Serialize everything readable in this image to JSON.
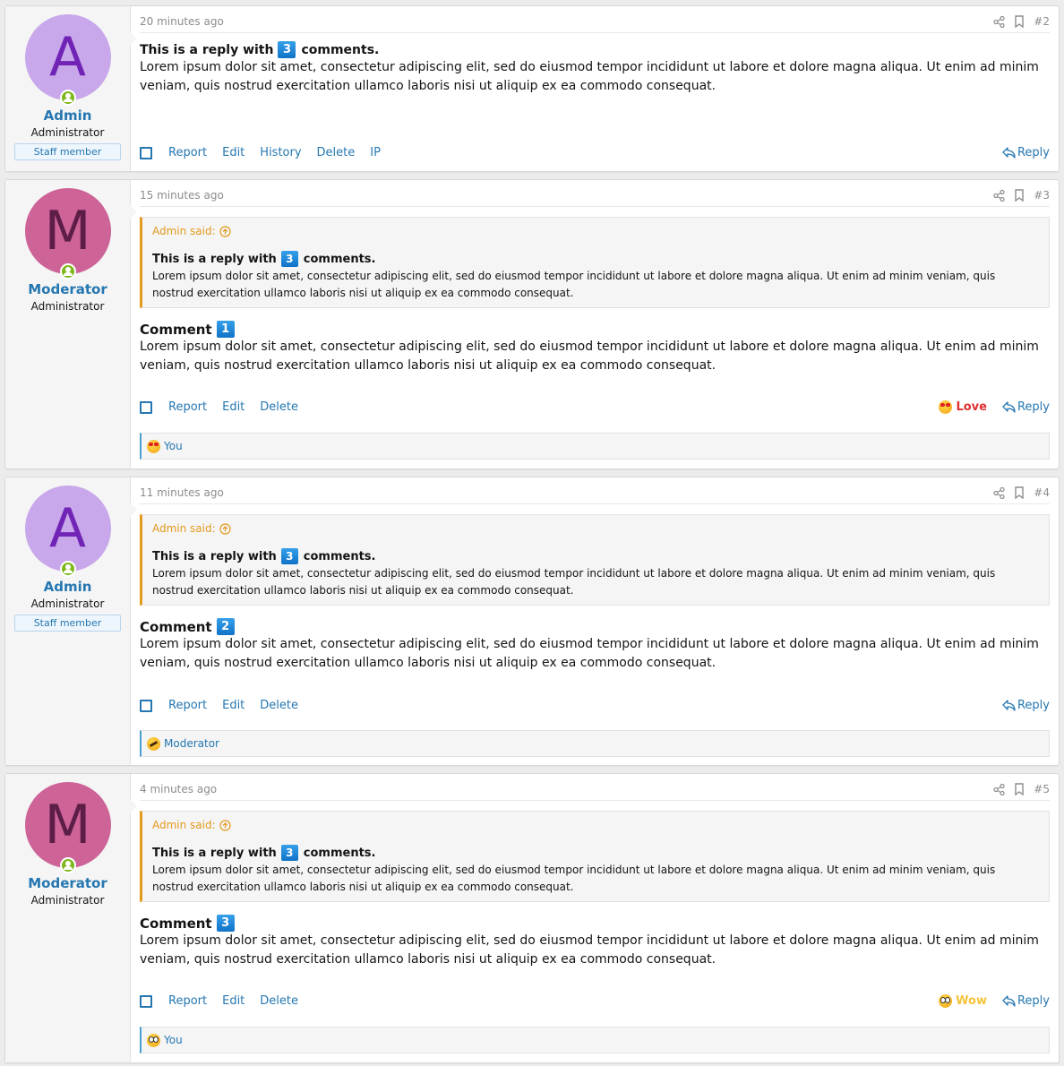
{
  "posts": [
    {
      "id": "2",
      "user": {
        "initial": "A",
        "name": "Admin",
        "title": "Administrator",
        "badge": "Staff member",
        "avatar_bg": "#c8a7eb",
        "avatar_fg": "#7123b5",
        "online": true
      },
      "time": "20 minutes ago",
      "number": "#2",
      "header_icons": [
        "share-icon",
        "bookmark-icon"
      ],
      "title_pre": "This is a reply with",
      "title_num": "3",
      "title_post": "comments.",
      "body": "Lorem ipsum dolor sit amet, consectetur adipiscing elit, sed do eiusmod tempor incididunt ut labore et dolore magna aliqua. Ut enim ad minim veniam, quis nostrud exercitation ullamco laboris nisi ut aliquip ex ea commodo consequat.",
      "actions": [
        "Report",
        "Edit",
        "History",
        "Delete",
        "IP"
      ],
      "reply_label": "Reply"
    },
    {
      "id": "3",
      "user": {
        "initial": "M",
        "name": "Moderator",
        "title": "Administrator",
        "avatar_bg": "#cd6396",
        "avatar_fg": "#5c1d47",
        "online": true
      },
      "time": "15 minutes ago",
      "number": "#3",
      "quote": {
        "author_label": "Admin said:",
        "title_pre": "This is a reply with",
        "title_num": "3",
        "title_post": "comments.",
        "body": "Lorem ipsum dolor sit amet, consectetur adipiscing elit, sed do eiusmod tempor incididunt ut labore et dolore magna aliqua. Ut enim ad minim veniam, quis nostrud exercitation ullamco laboris nisi ut aliquip ex ea commodo consequat."
      },
      "comment_label": "Comment",
      "comment_num": "1",
      "body": "Lorem ipsum dolor sit amet, consectetur adipiscing elit, sed do eiusmod tempor incididunt ut labore et dolore magna aliqua. Ut enim ad minim veniam, quis nostrud exercitation ullamco laboris nisi ut aliquip ex ea commodo consequat.",
      "actions": [
        "Report",
        "Edit",
        "Delete"
      ],
      "reaction_state": {
        "label": "Love",
        "icon": "love-emoji-icon",
        "color": "#e03030"
      },
      "reply_label": "Reply",
      "reactions_bar": {
        "icon": "love-emoji-icon",
        "users": "You"
      }
    },
    {
      "id": "4",
      "user": {
        "initial": "A",
        "name": "Admin",
        "title": "Administrator",
        "badge": "Staff member",
        "avatar_bg": "#c8a7eb",
        "avatar_fg": "#7123b5",
        "online": true
      },
      "time": "11 minutes ago",
      "number": "#4",
      "quote": {
        "author_label": "Admin said:",
        "title_pre": "This is a reply with",
        "title_num": "3",
        "title_post": "comments.",
        "body": "Lorem ipsum dolor sit amet, consectetur adipiscing elit, sed do eiusmod tempor incididunt ut labore et dolore magna aliqua. Ut enim ad minim veniam, quis nostrud exercitation ullamco laboris nisi ut aliquip ex ea commodo consequat."
      },
      "comment_label": "Comment",
      "comment_num": "2",
      "body": "Lorem ipsum dolor sit amet, consectetur adipiscing elit, sed do eiusmod tempor incididunt ut labore et dolore magna aliqua. Ut enim ad minim veniam, quis nostrud exercitation ullamco laboris nisi ut aliquip ex ea commodo consequat.",
      "actions": [
        "Report",
        "Edit",
        "Delete"
      ],
      "reply_label": "Reply",
      "reactions_bar": {
        "icon": "haha-emoji-icon",
        "users": "Moderator"
      }
    },
    {
      "id": "5",
      "user": {
        "initial": "M",
        "name": "Moderator",
        "title": "Administrator",
        "avatar_bg": "#cd6396",
        "avatar_fg": "#5c1d47",
        "online": true
      },
      "time": "4 minutes ago",
      "number": "#5",
      "quote": {
        "author_label": "Admin said:",
        "title_pre": "This is a reply with",
        "title_num": "3",
        "title_post": "comments.",
        "body": "Lorem ipsum dolor sit amet, consectetur adipiscing elit, sed do eiusmod tempor incididunt ut labore et dolore magna aliqua. Ut enim ad minim veniam, quis nostrud exercitation ullamco laboris nisi ut aliquip ex ea commodo consequat."
      },
      "comment_label": "Comment",
      "comment_num": "3",
      "body": "Lorem ipsum dolor sit amet, consectetur adipiscing elit, sed do eiusmod tempor incididunt ut labore et dolore magna aliqua. Ut enim ad minim veniam, quis nostrud exercitation ullamco laboris nisi ut aliquip ex ea commodo consequat.",
      "actions": [
        "Report",
        "Edit",
        "Delete"
      ],
      "reaction_state": {
        "label": "Wow",
        "icon": "wow-emoji-icon",
        "color": "#f5c33b"
      },
      "reply_label": "Reply",
      "reactions_bar": {
        "icon": "wow-emoji-icon",
        "users": "You"
      }
    }
  ],
  "colors": {
    "link": "#2577b1",
    "quote_accent": "#e39a1d",
    "badge_blue": "#1e88e5",
    "online_green": "#7fb81e"
  }
}
